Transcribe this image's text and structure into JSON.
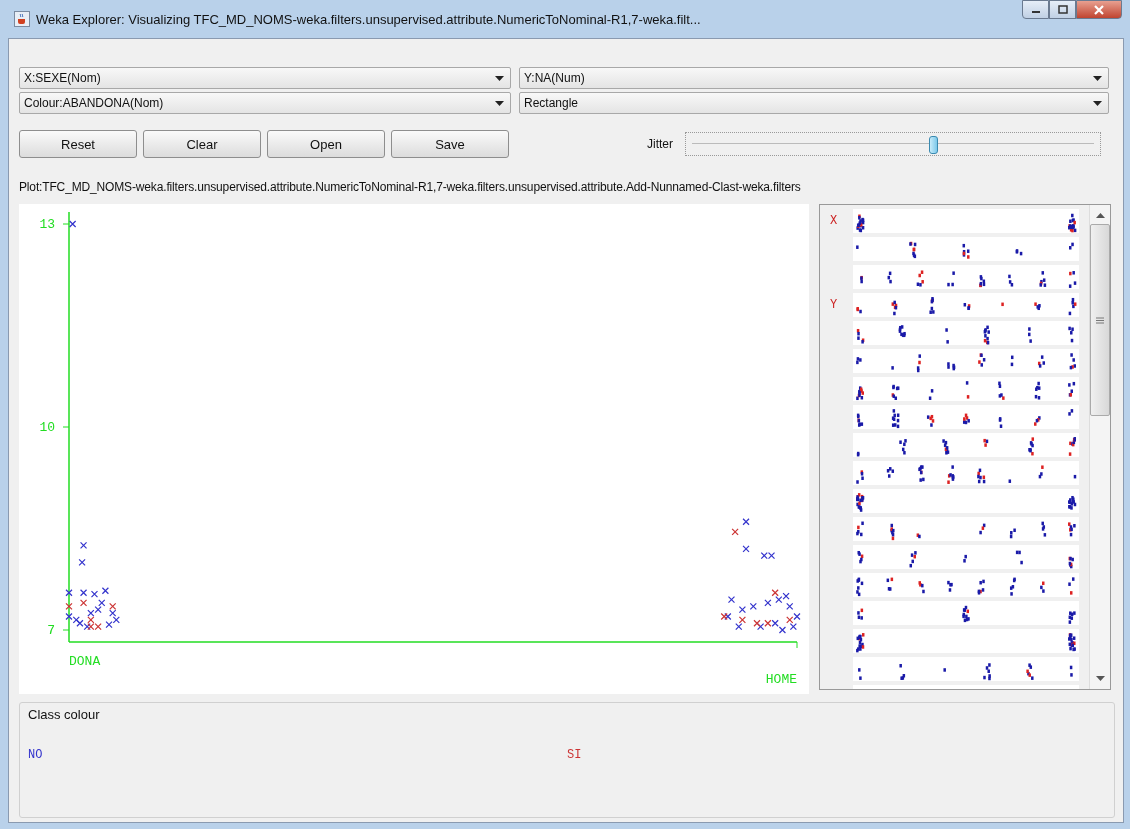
{
  "window": {
    "title": "Weka Explorer: Visualizing TFC_MD_NOMS-weka.filters.unsupervised.attribute.NumericToNominal-R1,7-weka.filt..."
  },
  "selectors": [
    {
      "value": "X:SEXE(Nom)"
    },
    {
      "value": "Y:NA(Num)"
    },
    {
      "value": "Colour:ABANDONA(Nom)"
    },
    {
      "value": "Rectangle"
    }
  ],
  "buttons": [
    "Reset",
    "Clear",
    "Open",
    "Save"
  ],
  "jitter": {
    "label": "Jitter",
    "level": 0.6
  },
  "plot_title": "Plot:TFC_MD_NOMS-weka.filters.unsupervised.attribute.NumericToNominal-R1,7-weka.filters.unsupervised.attribute.Add-Nunnamed-Clast-weka.filters",
  "plot": {
    "kind": "picture",
    "y_labels": [
      "13",
      "10",
      "7"
    ],
    "x_labels": [
      "DONA",
      "HOME"
    ]
  },
  "attribute_panel": {
    "rows": [
      {
        "kind": "strip",
        "marker": "X"
      },
      {
        "kind": "strip"
      },
      {
        "kind": "strip"
      },
      {
        "kind": "strip",
        "marker": "Y"
      },
      {
        "kind": "strip"
      },
      {
        "kind": "strip"
      },
      {
        "kind": "strip"
      },
      {
        "kind": "strip"
      },
      {
        "kind": "strip"
      },
      {
        "kind": "strip"
      },
      {
        "kind": "strip"
      },
      {
        "kind": "strip"
      },
      {
        "kind": "strip"
      },
      {
        "kind": "strip"
      },
      {
        "kind": "strip"
      },
      {
        "kind": "strip"
      },
      {
        "kind": "strip"
      },
      {
        "kind": "strip"
      }
    ]
  },
  "class_colour": {
    "title": "Class colour",
    "items": [
      {
        "label": "NO",
        "color": "#3333cc"
      },
      {
        "label": "SI",
        "color": "#cc3333"
      }
    ]
  }
}
